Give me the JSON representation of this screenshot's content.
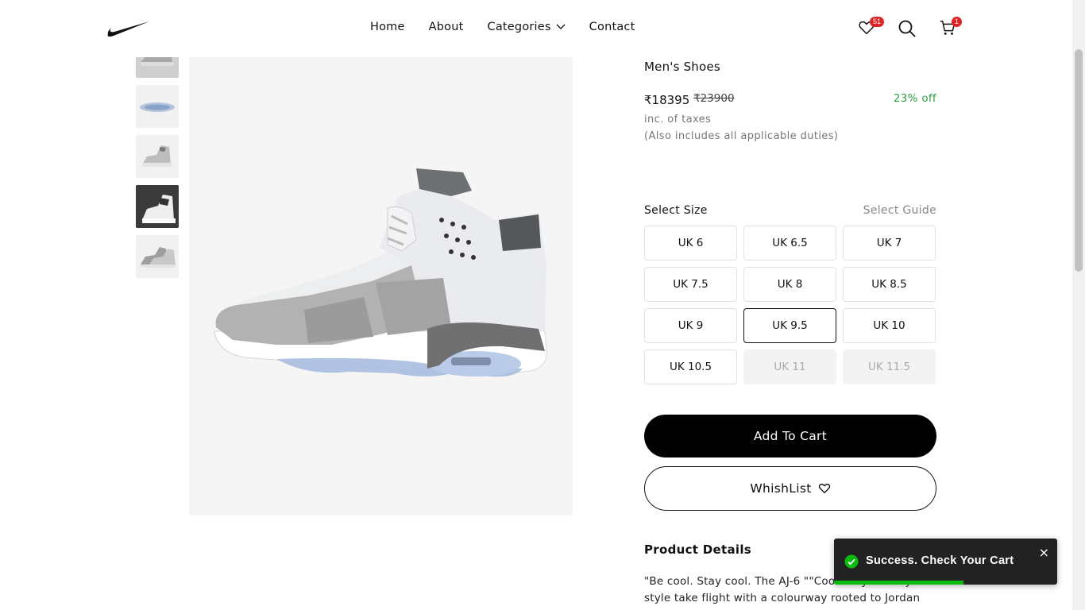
{
  "header": {
    "nav": [
      {
        "label": "Home"
      },
      {
        "label": "About"
      },
      {
        "label": "Categories"
      },
      {
        "label": "Contact"
      }
    ],
    "wishlist_count": "51",
    "cart_count": "1",
    "icons": [
      "nike-logo",
      "heart-icon",
      "search-icon",
      "cart-icon",
      "chevron-down-icon"
    ]
  },
  "product": {
    "subtitle": "Men's Shoes",
    "price": "₹18395",
    "old_price": "₹23900",
    "discount": "23% off",
    "taxes": "inc. of taxes",
    "duties": "(Also includes all applicable duties)",
    "size_label": "Select Size",
    "size_guide": "Select Guide",
    "sizes": [
      {
        "label": "UK 6",
        "state": "available"
      },
      {
        "label": "UK 6.5",
        "state": "available"
      },
      {
        "label": "UK 7",
        "state": "available"
      },
      {
        "label": "UK 7.5",
        "state": "available"
      },
      {
        "label": "UK 8",
        "state": "available"
      },
      {
        "label": "UK 8.5",
        "state": "available"
      },
      {
        "label": "UK 9",
        "state": "available"
      },
      {
        "label": "UK 9.5",
        "state": "selected"
      },
      {
        "label": "UK 10",
        "state": "available"
      },
      {
        "label": "UK 10.5",
        "state": "available"
      },
      {
        "label": "UK 11",
        "state": "disabled"
      },
      {
        "label": "UK 11.5",
        "state": "disabled"
      }
    ],
    "add_to_cart": "Add To Cart",
    "wishlist": "WhishList",
    "details_title": "Product Details",
    "details_text": "\"Be cool. Stay cool. The AJ-6 \"\"Cool Grey\"\" lets your style take flight with a colourway rooted to Jordan"
  },
  "toast": {
    "message": "Success. Check Your Cart",
    "close": "×",
    "progress": 0.58
  },
  "colors": {
    "accent": "#000000",
    "discount": "#2f9e44",
    "badge": "#e02424",
    "toast_bg": "#222222",
    "toast_success": "#07bc0c"
  }
}
